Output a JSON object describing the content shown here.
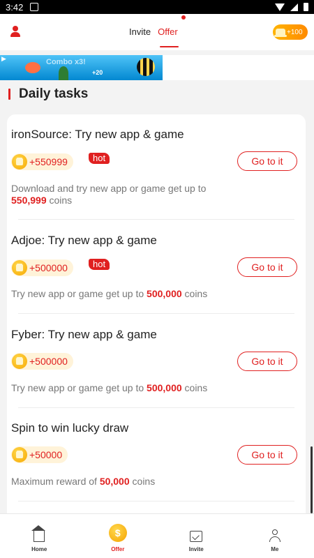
{
  "status_bar": {
    "time": "3:42"
  },
  "header": {
    "tabs": [
      {
        "label": "Invite"
      },
      {
        "label": "Offer"
      }
    ],
    "coin_pill": "+100"
  },
  "banner": {
    "combo_text": "Combo x3!",
    "plus_text": "+20",
    "badge": "20"
  },
  "section": {
    "title": "Daily tasks"
  },
  "tasks": [
    {
      "title": "ironSource: Try new app & game",
      "reward": "+550999",
      "hot": "hot",
      "button": "Go to it",
      "desc_prefix": "Download and try new app or game get up to ",
      "desc_highlight": "550,999",
      "desc_suffix": " coins"
    },
    {
      "title": "Adjoe: Try new app & game",
      "reward": "+500000",
      "hot": "hot",
      "button": "Go to it",
      "desc_prefix": "Try new app or game get up to ",
      "desc_highlight": "500,000",
      "desc_suffix": " coins"
    },
    {
      "title": "Fyber: Try new app & game",
      "reward": "+500000",
      "button": "Go to it",
      "desc_prefix": "Try new app or game get up to ",
      "desc_highlight": "500,000",
      "desc_suffix": " coins"
    },
    {
      "title": "Spin to win lucky draw",
      "reward": "+50000",
      "button": "Go to it",
      "desc_prefix": "Maximum reward of ",
      "desc_highlight": "50,000",
      "desc_suffix": " coins"
    }
  ],
  "bottom_nav": [
    {
      "label": "Home",
      "icon": "home-icon"
    },
    {
      "label": "Offer",
      "icon": "offer-coin-icon",
      "glyph": "$"
    },
    {
      "label": "Invite",
      "icon": "mail-icon"
    },
    {
      "label": "Me",
      "icon": "person-icon"
    }
  ],
  "colors": {
    "accent": "#e02020",
    "coin": "#f7a800"
  }
}
